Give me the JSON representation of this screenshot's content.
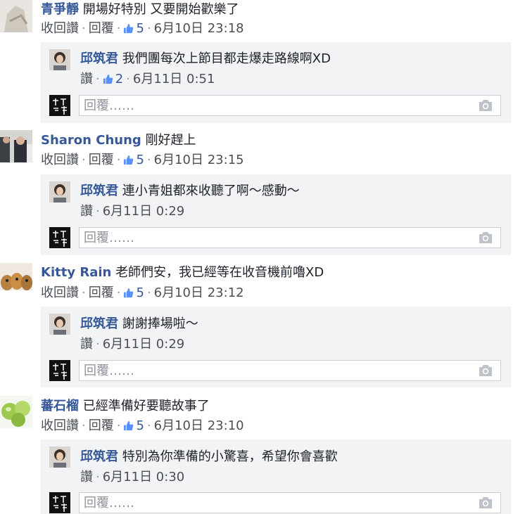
{
  "comments": [
    {
      "author": "青爭靜",
      "text": "開場好特別 又要開始歡樂了",
      "actions": {
        "unlike": "收回讚",
        "reply": "回覆"
      },
      "likes": "5",
      "time": "6月10日 23:18",
      "reply": {
        "author": "邱筑君",
        "text": "我們團每次上節目都走爆走路線啊XD",
        "like": "讚",
        "likes": "2",
        "time": "6月11日 0:51"
      },
      "reply_placeholder": "回覆……"
    },
    {
      "author": "Sharon Chung",
      "text": "剛好趕上",
      "actions": {
        "unlike": "收回讚",
        "reply": "回覆"
      },
      "likes": "5",
      "time": "6月10日 23:15",
      "reply": {
        "author": "邱筑君",
        "text": "連小青姐都來收聽了啊～感動～",
        "like": "讚",
        "time": "6月11日 0:29"
      },
      "reply_placeholder": "回覆……"
    },
    {
      "author": "Kitty Rain",
      "text": "老師們安，我已經等在收音機前嚕XD",
      "actions": {
        "unlike": "收回讚",
        "reply": "回覆"
      },
      "likes": "5",
      "time": "6月10日 23:12",
      "reply": {
        "author": "邱筑君",
        "text": "謝謝捧場啦～",
        "like": "讚",
        "time": "6月11日 0:29"
      },
      "reply_placeholder": "回覆……"
    },
    {
      "author": "蕃石榴",
      "text": "已經準備好要聽故事了",
      "actions": {
        "unlike": "收回讚",
        "reply": "回覆"
      },
      "likes": "5",
      "time": "6月10日 23:10",
      "reply": {
        "author": "邱筑君",
        "text": "特別為你準備的小驚喜，希望你會喜歡",
        "like": "讚",
        "time": "6月11日 0:30"
      },
      "reply_placeholder": "回覆……"
    }
  ],
  "colors": {
    "link": "#365899",
    "meta": "#4b4f56",
    "reply_bg": "#f2f3f5",
    "text": "#1d2129"
  },
  "icons": [
    "thumbs-up-icon",
    "camera-icon"
  ]
}
